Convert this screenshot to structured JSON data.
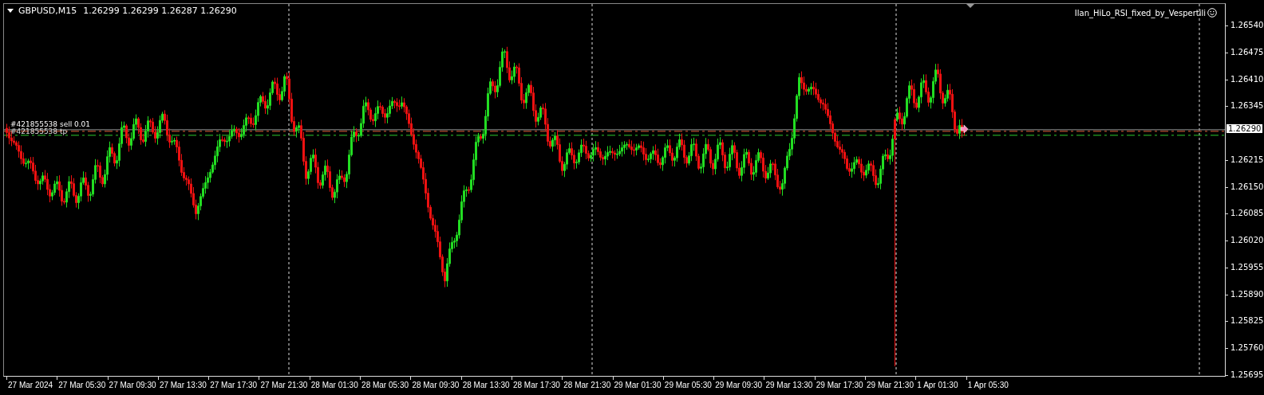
{
  "chart": {
    "symbol": "GBPUSD,M15",
    "quotes": "1.26299 1.26299 1.26287 1.26290",
    "indicator": "Ilan_HiLo_RSI_fixed_by_Vespertili",
    "orders": [
      {
        "label": "#421855538 sell 0.01",
        "kind": "entry"
      },
      {
        "label": "#421855538 tp",
        "kind": "tp"
      }
    ]
  },
  "price_axis": {
    "current_price": "1.26290",
    "ticks": [
      "1.26540",
      "1.26475",
      "1.26410",
      "1.26345",
      "1.26215",
      "1.26150",
      "1.26085",
      "1.26020",
      "1.25955",
      "1.25890",
      "1.25825",
      "1.25760",
      "1.25695"
    ]
  },
  "time_axis": [
    "27 Mar 2024",
    "27 Mar 05:30",
    "27 Mar 09:30",
    "27 Mar 13:30",
    "27 Mar 17:30",
    "27 Mar 21:30",
    "28 Mar 01:30",
    "28 Mar 05:30",
    "28 Mar 09:30",
    "28 Mar 13:30",
    "28 Mar 17:30",
    "28 Mar 21:30",
    "29 Mar 01:30",
    "29 Mar 05:30",
    "29 Mar 09:30",
    "29 Mar 13:30",
    "29 Mar 17:30",
    "29 Mar 21:30",
    "1 Apr 01:30",
    "1 Apr 05:30"
  ]
}
